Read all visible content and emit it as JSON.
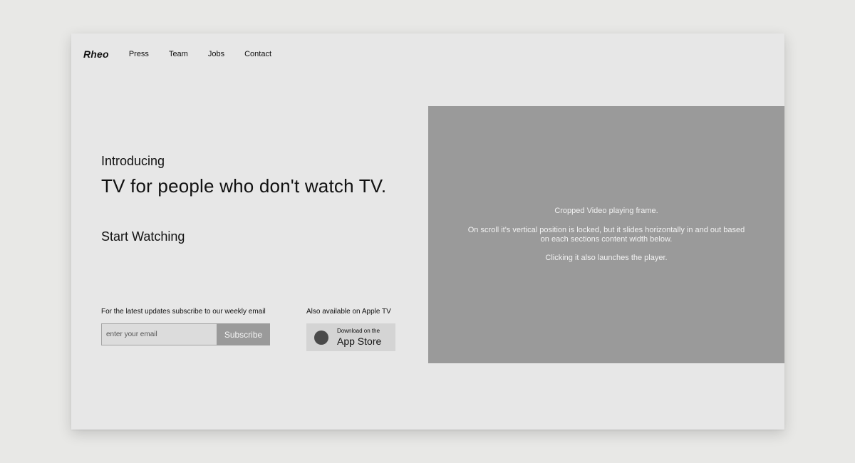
{
  "nav": {
    "logo": "Rheo",
    "links": [
      "Press",
      "Team",
      "Jobs",
      "Contact"
    ]
  },
  "hero": {
    "intro": "Introducing",
    "headline": "TV for people who don't watch TV.",
    "cta": "Start Watching"
  },
  "subscribe": {
    "label": "For the latest updates subscribe to our weekly email",
    "placeholder": "enter your email",
    "button": "Subscribe"
  },
  "apple": {
    "label": "Also available on Apple TV",
    "badge_small": "Download on the",
    "badge_big": "App Store"
  },
  "video": {
    "line1": "Cropped Video playing frame.",
    "line2": "On scroll it's vertical position is locked, but it slides horizontally in and out based on each sections content width below.",
    "line3": "Clicking it also launches the player."
  }
}
